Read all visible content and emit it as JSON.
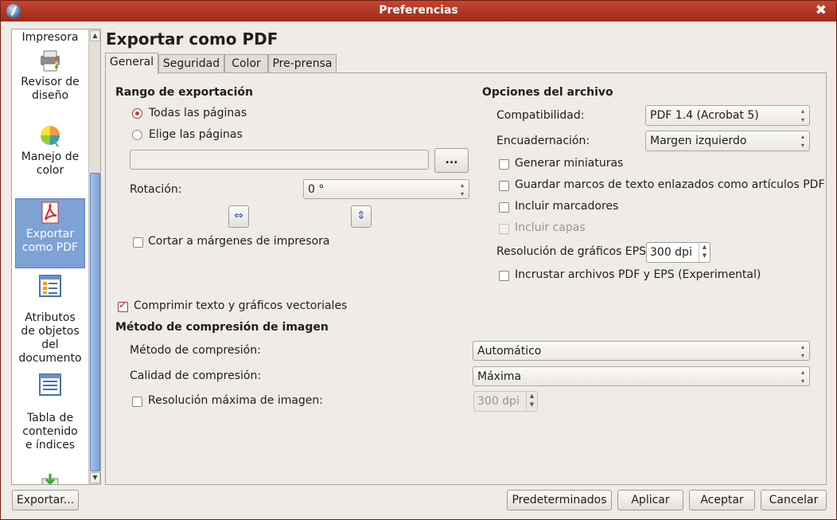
{
  "window": {
    "title": "Preferencias"
  },
  "sidebar": {
    "items": [
      {
        "label": "Impresora",
        "icon": "printer-icon"
      },
      {
        "label": "Revisor de diseño",
        "icon": "preflight-icon"
      },
      {
        "label": "Manejo de color",
        "icon": "color-wheel-icon"
      },
      {
        "label": "Exportar como PDF",
        "icon": "pdf-icon",
        "selected": true
      },
      {
        "label": "Atributos de objetos del documento",
        "icon": "attributes-icon"
      },
      {
        "label": "Tabla de contenido e índices",
        "icon": "toc-icon"
      },
      {
        "label": "",
        "icon": "download-icon"
      }
    ]
  },
  "page": {
    "title": "Exportar como PDF"
  },
  "tabs": [
    {
      "label": "General",
      "active": true
    },
    {
      "label": "Seguridad"
    },
    {
      "label": "Color"
    },
    {
      "label": "Pre-prensa"
    }
  ],
  "export_range": {
    "heading": "Rango de exportación",
    "all_pages": "Todas las páginas",
    "choose_pages": "Elige las páginas",
    "browse_label": "...",
    "rotation_label": "Rotación:",
    "rotation_value": "0 °",
    "clip_margins": "Cortar a márgenes de impresora"
  },
  "file_options": {
    "heading": "Opciones del archivo",
    "compat_label": "Compatibilidad:",
    "compat_value": "PDF 1.4 (Acrobat 5)",
    "binding_label": "Encuadernación:",
    "binding_value": "Margen izquierdo",
    "gen_thumbs": "Generar miniaturas",
    "save_frames": "Guardar marcos de texto enlazados como artículos PDF",
    "bookmarks": "Incluir marcadores",
    "layers": "Incluir capas",
    "eps_res_label": "Resolución de gráficos EPS:",
    "eps_res_value": "300 dpi",
    "embed_pdf_eps": "Incrustar archivos PDF y EPS (Experimental)"
  },
  "compression": {
    "compress_vectors": "Comprimir texto y gráficos vectoriales",
    "heading": "Método de compresión de imagen",
    "method_label": "Método de compresión:",
    "method_value": "Automático",
    "quality_label": "Calidad de compresión:",
    "quality_value": "Máxima",
    "max_res_label": "Resolución máxima de imagen:",
    "max_res_value": "300 dpi"
  },
  "footer": {
    "export_btn": "Exportar...",
    "defaults_btn": "Predeterminados",
    "apply_btn": "Aplicar",
    "accept_btn": "Aceptar",
    "cancel_btn": "Cancelar"
  }
}
